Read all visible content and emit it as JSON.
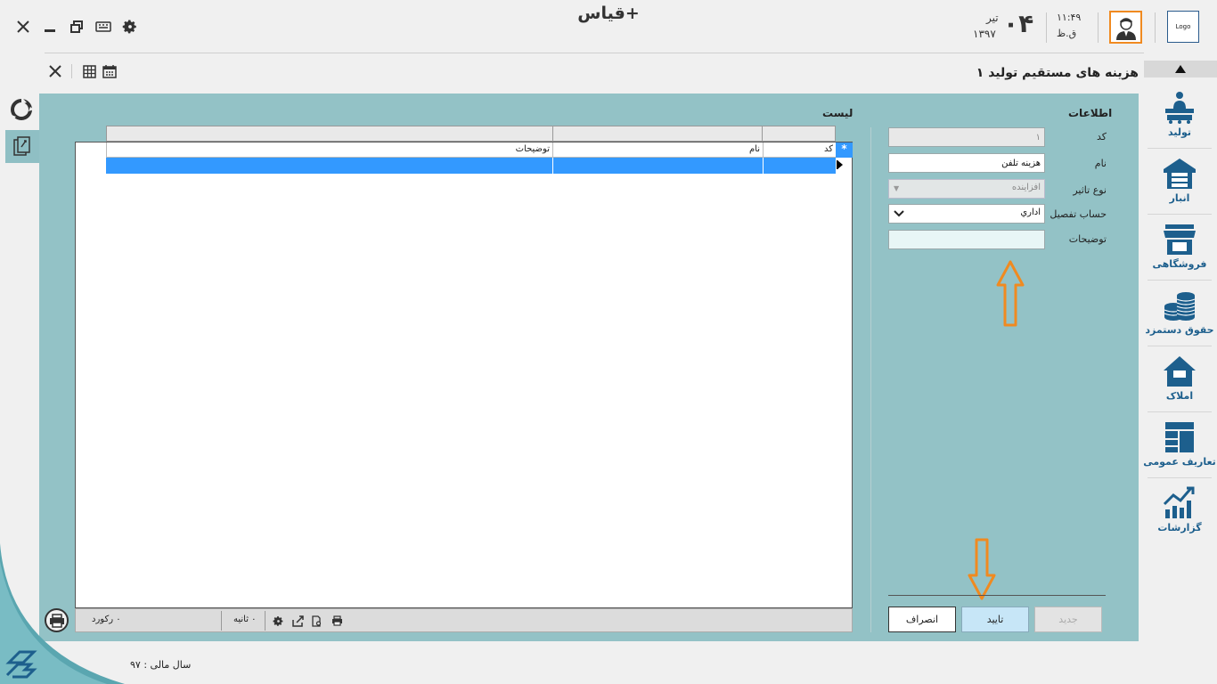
{
  "app": {
    "title": "قیاس+"
  },
  "header": {
    "date_day": "۰۴",
    "date_month": "تیر",
    "date_year": "۱۳۹۷",
    "time": "۱۱:۴۹",
    "time_period": "ق.ظ",
    "logo_text": "Logo"
  },
  "form": {
    "title": "هزینه های مستقیم تولید ۱"
  },
  "info": {
    "title": "اطلاعات",
    "fields": {
      "code": {
        "label": "کد",
        "value": "۱"
      },
      "name": {
        "label": "نام",
        "value": "هزینه تلفن"
      },
      "type": {
        "label": "نوع تاثیر",
        "value": "افزاینده"
      },
      "account": {
        "label": "حساب تفصیل",
        "value": "اداري"
      },
      "description": {
        "label": "توضیحات",
        "value": ""
      }
    },
    "buttons": {
      "new": "جدید",
      "ok": "تایید",
      "cancel": "انصراف"
    }
  },
  "list": {
    "title": "لیست",
    "columns": [
      "کد",
      "نام",
      "توضیحات"
    ],
    "new_row_symbol": "*"
  },
  "status": {
    "records": "۰ رکورد",
    "seconds": "۰ ثانیه"
  },
  "sidebar": {
    "items": [
      {
        "label": "تولید",
        "icon": "production-icon"
      },
      {
        "label": "انبار",
        "icon": "warehouse-icon"
      },
      {
        "label": "فروشگاهی",
        "icon": "store-icon"
      },
      {
        "label": "حقوق دستمزد",
        "icon": "coins-icon"
      },
      {
        "label": "املاک",
        "icon": "house-icon"
      },
      {
        "label": "تعاریف عمومی",
        "icon": "layout-icon"
      },
      {
        "label": "گزارشات",
        "icon": "chart-icon"
      }
    ]
  },
  "footer": {
    "fiscal_year": "سال مالی : ۹۷"
  },
  "colors": {
    "panel": "#93c2c6",
    "accent": "#1d5f8d",
    "selection": "#3399ff",
    "highlight": "#f08a20"
  }
}
